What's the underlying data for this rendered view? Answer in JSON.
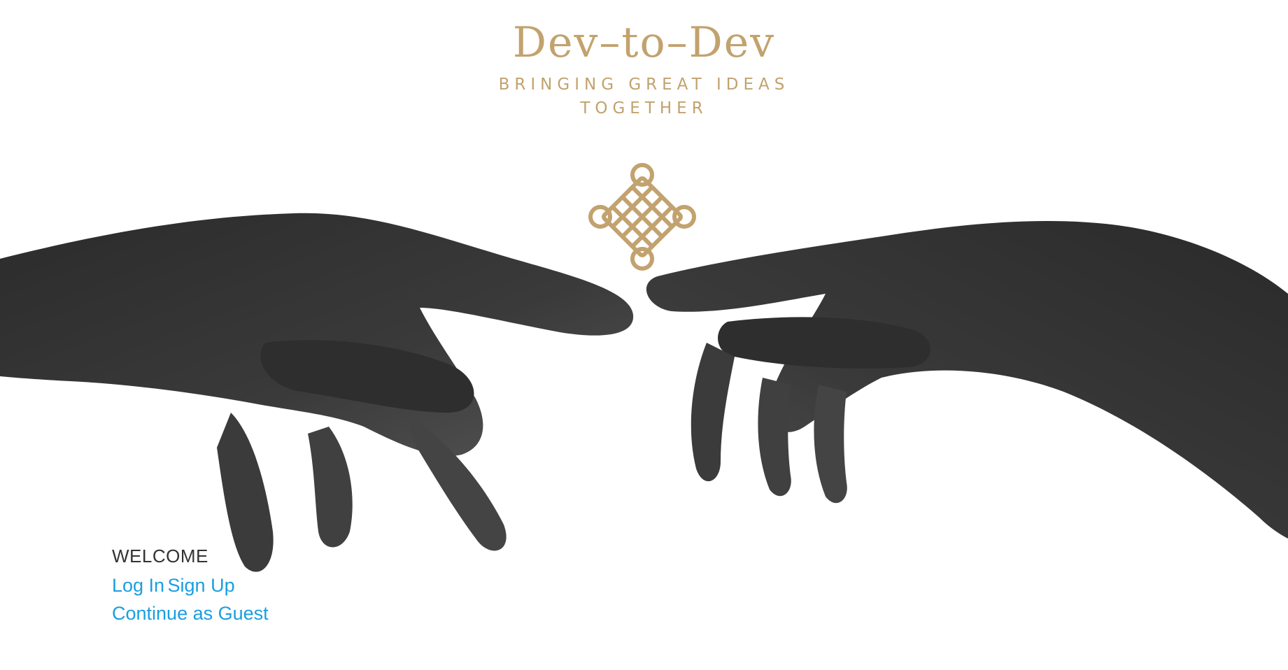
{
  "brand": {
    "title": "Dev–to–Dev",
    "tagline": "BRINGING GREAT IDEAS TOGETHER",
    "color": "#c2a26e"
  },
  "welcome": {
    "heading": "WELCOME",
    "login_label": "Log In",
    "signup_label": "Sign Up",
    "guest_label": "Continue as Guest",
    "link_color": "#1a9ee0"
  },
  "icons": {
    "emblem": "knot-emblem-icon",
    "left_hand": "reaching-hand-left-image",
    "right_hand": "reaching-hand-right-image"
  }
}
